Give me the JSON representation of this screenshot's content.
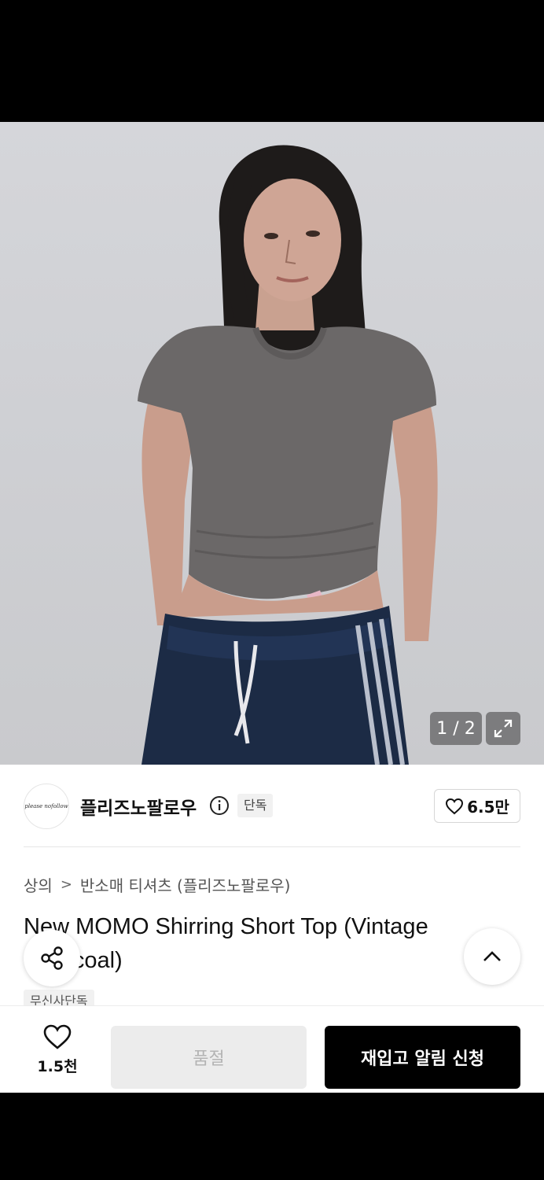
{
  "gallery": {
    "counter": "1 / 2",
    "expand_icon": "expand-icon"
  },
  "brand": {
    "logo_text": "please nofollow",
    "name": "플리즈노팔로우",
    "info_icon": "info-icon",
    "exclusive_tag": "단독",
    "like_icon": "heart-icon",
    "like_count": "6.5만"
  },
  "breadcrumb": {
    "category": "상의",
    "separator": ">",
    "subcategory": "반소매 티셔츠 (플리즈노팔로우)"
  },
  "product": {
    "title": "New MOMO Shirring Short Top (Vintage Charcoal)",
    "tag": "무신사단독"
  },
  "floating": {
    "share_icon": "share-icon",
    "scroll_top_icon": "chevron-up-icon"
  },
  "bottom_bar": {
    "like_icon": "heart-outline-icon",
    "like_count": "1.5천",
    "soldout_label": "품절",
    "restock_label": "재입고 알림 신청"
  },
  "colors": {
    "primary": "#000000",
    "disabled_bg": "#ececec",
    "disabled_text": "#b4b4b4"
  }
}
